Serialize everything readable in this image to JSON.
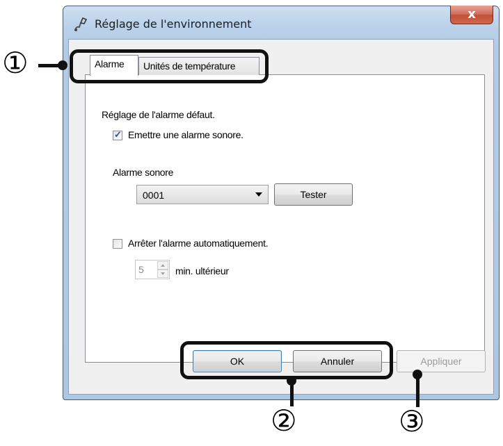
{
  "window": {
    "title": "Réglage de l'environnement",
    "close_label": "x"
  },
  "tabs": [
    {
      "label": "Alarme",
      "selected": true
    },
    {
      "label": "Unités de température",
      "selected": false
    }
  ],
  "alarm": {
    "section_label": "Réglage de l'alarme défaut.",
    "beep_checkbox": {
      "label": "Emettre une alarme sonore.",
      "checked": true
    },
    "sound_label": "Alarme sonore",
    "sound_select": {
      "value": "0001"
    },
    "test_button": "Tester",
    "auto_stop_checkbox": {
      "label": "Arrêter l'alarme automatiquement.",
      "checked": false
    },
    "minutes_value": "5",
    "minutes_suffix": "min. ultérieur"
  },
  "buttons": {
    "ok": "OK",
    "cancel": "Annuler",
    "apply": "Appliquer"
  },
  "callouts": [
    "①",
    "②",
    "③"
  ],
  "colors": {
    "frame": "#b9d1ea",
    "close": "#c24f36",
    "callout": "#111111"
  }
}
